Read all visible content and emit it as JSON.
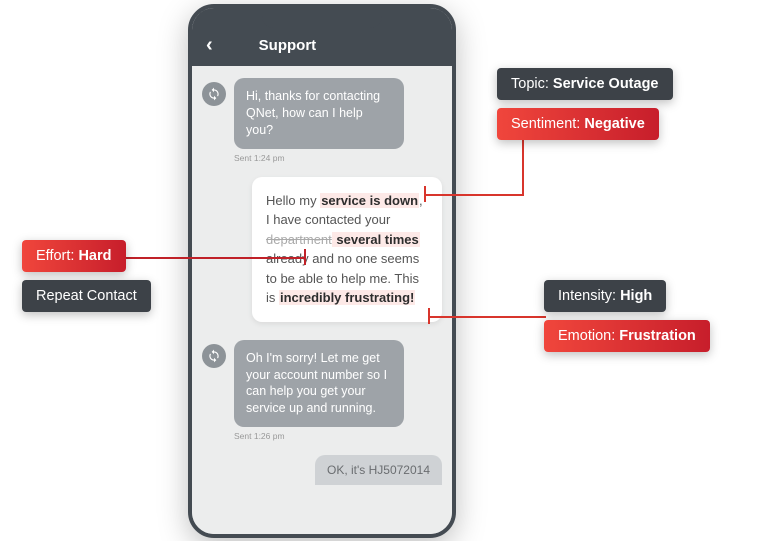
{
  "header": {
    "back_label": "‹",
    "title": "Support"
  },
  "messages": {
    "agent1": "Hi, thanks for contacting QNet, how can I help you?",
    "agent1_meta": "Sent 1:24 pm",
    "user_parts": {
      "p1": "Hello my ",
      "h1": "service is down",
      "p2": ", I have contacted your ",
      "strike": "department",
      "h2": " several times",
      "p3": " already and no one seems to be able to help me. This is ",
      "h3": "incredibly frustrating!"
    },
    "agent2": "Oh I'm sorry! Let me get your account number so I can help you get your service up and running.",
    "agent2_meta": "Sent 1:26 pm",
    "user2": "OK, it's HJ5072014"
  },
  "annotations": {
    "topic_label": "Topic: ",
    "topic_value": "Service Outage",
    "sentiment_label": "Sentiment: ",
    "sentiment_value": "Negative",
    "intensity_label": "Intensity: ",
    "intensity_value": "High",
    "emotion_label": "Emotion: ",
    "emotion_value": "Frustration",
    "effort_label": "Effort: ",
    "effort_value": "Hard",
    "repeat_label": "Repeat Contact"
  }
}
